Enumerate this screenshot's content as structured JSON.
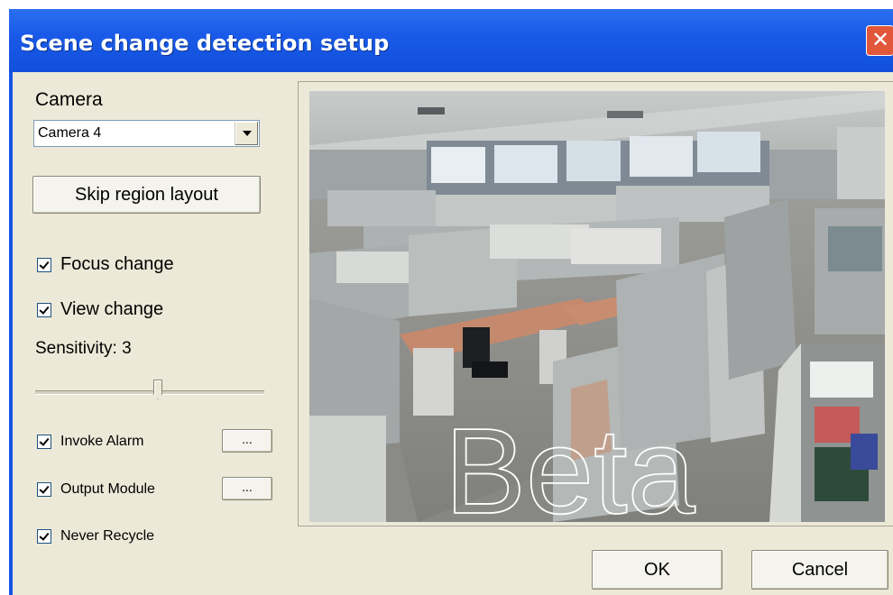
{
  "window": {
    "title": "Scene change detection setup",
    "close_glyph": "✕"
  },
  "camera": {
    "label": "Camera",
    "selected": "Camera 4"
  },
  "skip_region_button": "Skip region layout",
  "focus_change": {
    "label": "Focus change",
    "checked": true
  },
  "view_change": {
    "label": "View change",
    "checked": true
  },
  "sensitivity": {
    "label": "Sensitivity: 3",
    "value": 3
  },
  "invoke_alarm": {
    "label": "Invoke Alarm",
    "checked": true,
    "button": "..."
  },
  "output_module": {
    "label": "Output Module",
    "checked": true,
    "button": "..."
  },
  "never_recycle": {
    "label": "Never Recycle",
    "checked": true
  },
  "preview": {
    "watermark": "Beta"
  },
  "footer": {
    "ok": "OK",
    "cancel": "Cancel"
  },
  "icons": {
    "close": "close-icon",
    "dropdown": "chevron-down-icon",
    "checkbox": "checkmark-icon"
  },
  "colors": {
    "titlebar": "#1a5ae8",
    "dialog_bg": "#ece9d8",
    "close_button": "#e0573a"
  }
}
